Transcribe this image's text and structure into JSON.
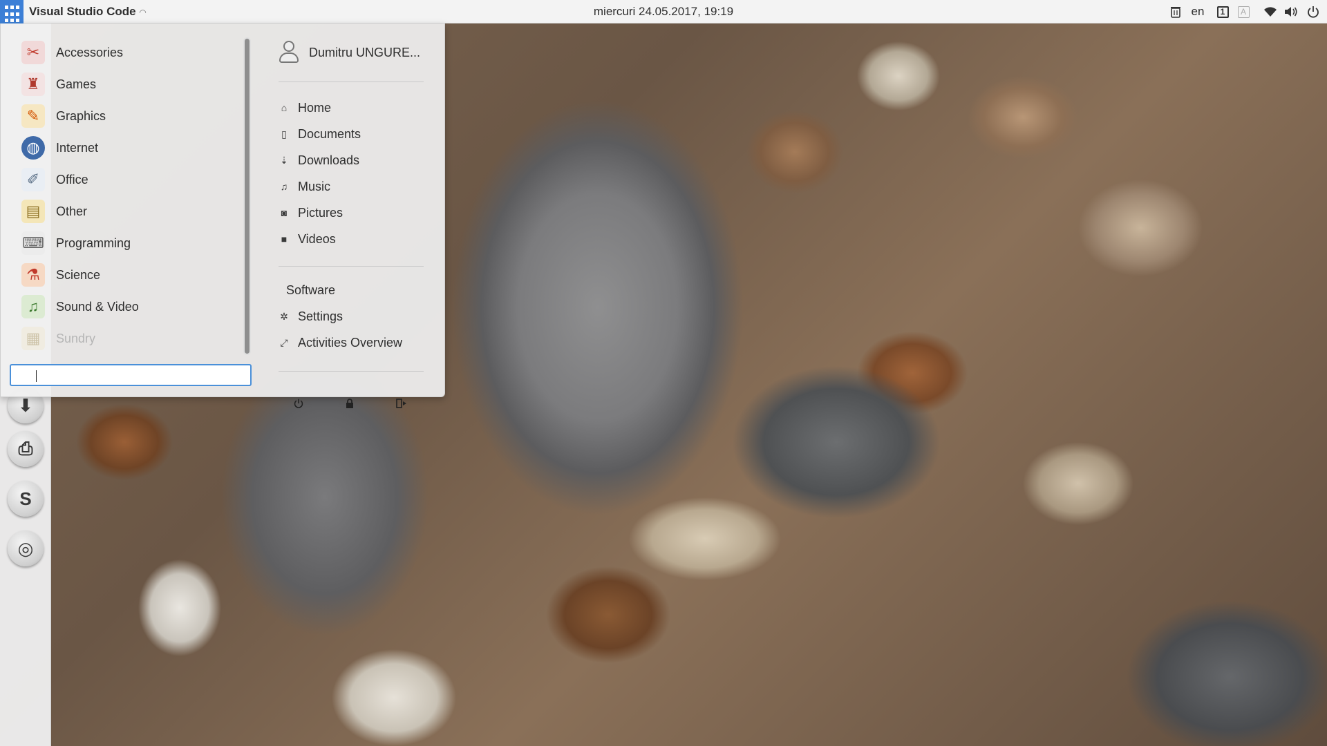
{
  "topbar": {
    "active_app": "Visual Studio Code",
    "clock": "miercuri 24.05.2017, 19:19",
    "language": "en",
    "workspace": "1",
    "input_indicator": "A"
  },
  "menu": {
    "categories": [
      {
        "label": "Accessories",
        "icon": "accessories-icon"
      },
      {
        "label": "Games",
        "icon": "games-icon"
      },
      {
        "label": "Graphics",
        "icon": "graphics-icon"
      },
      {
        "label": "Internet",
        "icon": "internet-icon"
      },
      {
        "label": "Office",
        "icon": "office-icon"
      },
      {
        "label": "Other",
        "icon": "other-icon"
      },
      {
        "label": "Programming",
        "icon": "programming-icon"
      },
      {
        "label": "Science",
        "icon": "science-icon"
      },
      {
        "label": "Sound & Video",
        "icon": "sound-video-icon"
      },
      {
        "label": "Sundry",
        "icon": "sundry-icon"
      }
    ],
    "search": {
      "value": "",
      "placeholder": ""
    },
    "user": "Dumitru UNGURE...",
    "places": [
      {
        "label": "Home",
        "icon": "home-icon"
      },
      {
        "label": "Documents",
        "icon": "document-icon"
      },
      {
        "label": "Downloads",
        "icon": "download-icon"
      },
      {
        "label": "Music",
        "icon": "music-icon"
      },
      {
        "label": "Pictures",
        "icon": "camera-icon"
      },
      {
        "label": "Videos",
        "icon": "video-icon"
      }
    ],
    "software": "Software",
    "settings": "Settings",
    "activities": "Activities Overview"
  },
  "colors": {
    "accent": "#3c7fd6",
    "search_border": "#4a90d9",
    "panel_bg": "#f3f3f3"
  }
}
